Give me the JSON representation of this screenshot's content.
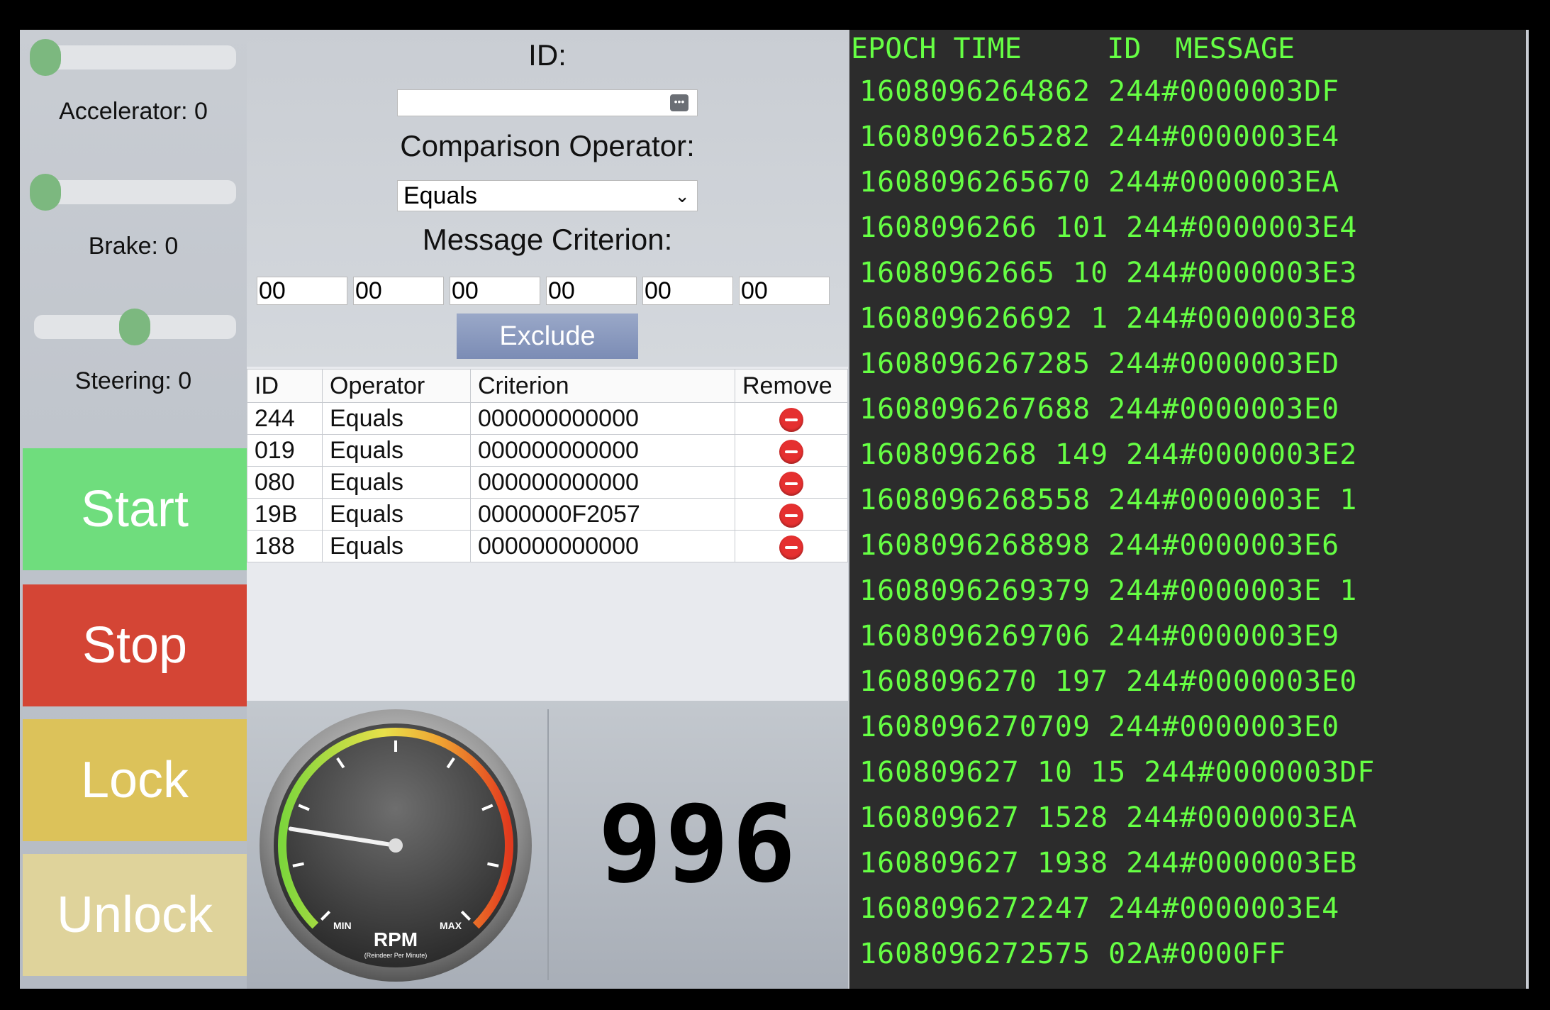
{
  "sliders": [
    {
      "label": "Accelerator: 0",
      "level": 0.0
    },
    {
      "label": "Brake: 0",
      "level": 0.0
    },
    {
      "label": "Steering: 0",
      "level": 0.5
    }
  ],
  "buttons": {
    "start": "Start",
    "stop": "Stop",
    "lock": "Lock",
    "unlock": "Unlock",
    "colors": {
      "start": "#6fdd7d",
      "stop": "#d44535",
      "lock": "#dcc25a",
      "unlock": "#dfd39b"
    }
  },
  "filter": {
    "id_label": "ID:",
    "id_value": "",
    "operator_label": "Comparison Operator:",
    "operator_value": "Equals",
    "criterion_label": "Message Criterion:",
    "criterion_bytes": [
      "00",
      "00",
      "00",
      "00",
      "00",
      "00"
    ],
    "exclude_label": "Exclude"
  },
  "rules": {
    "headers": [
      "ID",
      "Operator",
      "Criterion",
      "Remove"
    ],
    "rows": [
      {
        "id": "244",
        "op": "Equals",
        "crit": "000000000000"
      },
      {
        "id": "019",
        "op": "Equals",
        "crit": "000000000000"
      },
      {
        "id": "080",
        "op": "Equals",
        "crit": "000000000000"
      },
      {
        "id": "19B",
        "op": "Equals",
        "crit": "0000000F2057"
      },
      {
        "id": "188",
        "op": "Equals",
        "crit": "000000000000"
      }
    ]
  },
  "gauge": {
    "title": "RPM",
    "subtitle": "(Reindeer Per Minute)",
    "min_label": "MIN",
    "max_label": "MAX",
    "needle_level": 0.2
  },
  "rpm_value": "996",
  "log": {
    "header": "EPOCH TIME     ID  MESSAGE",
    "rows": [
      "1608096264862 244#0000003DF",
      "1608096265282 244#0000003E4",
      "1608096265670 244#0000003EA",
      "1608096266 101 244#0000003E4",
      "16080962665 10 244#0000003E3",
      "160809626692 1 244#0000003E8",
      "1608096267285 244#0000003ED",
      "1608096267688 244#0000003E0",
      "1608096268 149 244#0000003E2",
      "1608096268558 244#0000003E 1",
      "1608096268898 244#0000003E6",
      "1608096269379 244#0000003E 1",
      "1608096269706 244#0000003E9",
      "1608096270 197 244#0000003E0",
      "1608096270709 244#0000003E0",
      "160809627 10 15 244#0000003DF",
      "160809627 1528 244#0000003EA",
      "160809627 1938 244#0000003EB",
      "1608096272247 244#0000003E4",
      "1608096272575 02A#0000FF"
    ]
  }
}
